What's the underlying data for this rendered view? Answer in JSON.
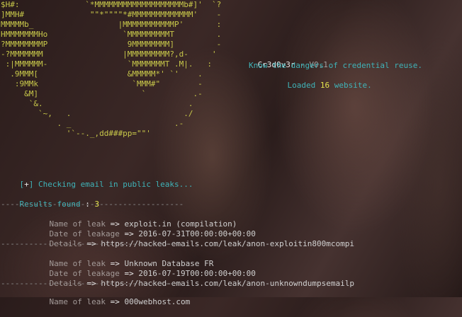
{
  "ascii_art": [
    "$H#:              `*MMMMMMMMMMMMMMMMMMMb#]'  `?",
    "]MMH#              \"\"*\"\"\"\"*#MMMMMMMMMMMMM'    -",
    "MMMMMb_                  |MMMMMMMMMMMP'       :",
    "HMMMMMMMHo                `MMMMMMMMMT         .",
    "?MMMMMMMMP                 9MMMMMMMM]         -",
    "-?MMMMMMM                 |MMMMMMMMM?,d-     '",
    " :|MMMMMM-                 `MMMMMMMT .M|.   :",
    "  .9MMM[                   &MMMMM*' `'    .",
    "   :9MMk                    `MMM#\"        -",
    "     &M]                      `          .-",
    "      `&.                               .",
    "        `~,   .                        ./",
    "            . _                      .-",
    "              '`--._,dd###pp=\"\"'"
  ],
  "banner": {
    "name": "Cr3d0v3r",
    "separator": " - ",
    "version": "V0.1",
    "tagline": "Know the dangers of credential reuse.",
    "loaded_prefix": "Loaded ",
    "loaded_count": "16",
    "loaded_suffix": " website."
  },
  "status": {
    "bracket_open": "[",
    "marker": "+",
    "bracket_close": "]",
    "text": " Checking email in public leaks..."
  },
  "results": {
    "label": "Results found",
    "sep": " : ",
    "count": "3"
  },
  "separator_line": "---------------------------------------",
  "field_labels": {
    "name": "Name of leak",
    "date": "Date of leakage",
    "details": "Details"
  },
  "arrow": "=>",
  "leaks": [
    {
      "name": "exploit.in (compilation)",
      "date": "2016-07-31T00:00:00+00:00",
      "details": "https://hacked-emails.com/leak/anon-exploitin800mcompi"
    },
    {
      "name": "Unknown Database FR",
      "date": "2016-07-19T00:00:00+00:00",
      "details": "https://hacked-emails.com/leak/anon-unknowndumpsemailp"
    },
    {
      "name": "000webhost.com"
    }
  ],
  "colors": {
    "art": "#c8c84a",
    "cyan": "#3fb3b8",
    "yellow": "#e4e44c",
    "green": "#9ed96a"
  }
}
